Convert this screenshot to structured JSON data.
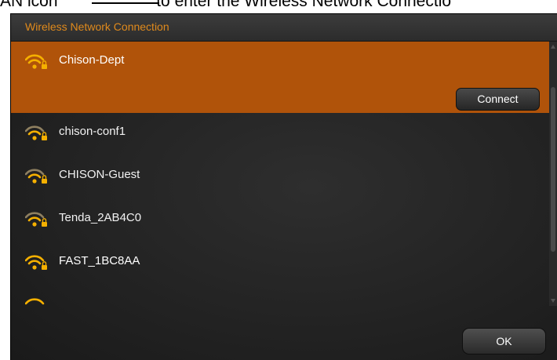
{
  "doc_text": {
    "before": "AN icon",
    "after": "to enter the Wireless Network Connectio"
  },
  "dialog": {
    "title": "Wireless Network Connection",
    "connect_label": "Connect",
    "ok_label": "OK"
  },
  "networks": [
    {
      "ssid": "Chison-Dept",
      "selected": true,
      "secured": true
    },
    {
      "ssid": "chison-conf1",
      "selected": false,
      "secured": true
    },
    {
      "ssid": "CHISON-Guest",
      "selected": false,
      "secured": true
    },
    {
      "ssid": "Tenda_2AB4C0",
      "selected": false,
      "secured": true
    },
    {
      "ssid": "FAST_1BC8AA",
      "selected": false,
      "secured": true
    },
    {
      "ssid": "",
      "selected": false,
      "secured": true
    }
  ],
  "colors": {
    "accent": "#e08a1c",
    "selected_row": "#b0530a",
    "dialog_bg": "#252525"
  },
  "icons": {
    "network": "wifi-lock-icon"
  }
}
